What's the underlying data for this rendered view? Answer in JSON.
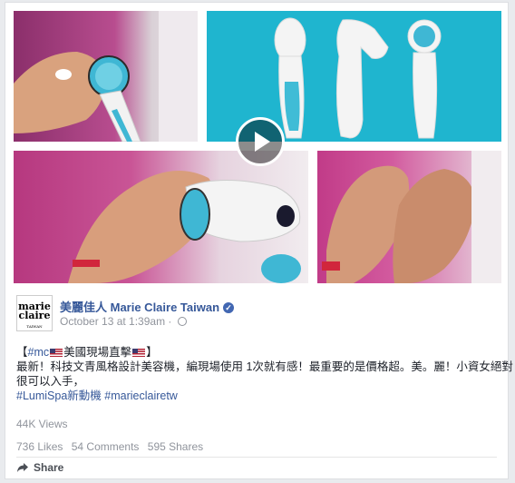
{
  "post": {
    "page_name": "美麗佳人 Marie Claire Taiwan",
    "timestamp": "October 13 at 1:39am",
    "logo_text_1": "marie",
    "logo_text_2": "claire",
    "logo_sub": "TAIWAN",
    "text_line1_pre": "【",
    "text_line1_tag": "#mc",
    "text_line1_mid": "美國現場直擊",
    "text_line1_end": "】",
    "text_line2": "最新！科技文青風格設計美容機，編現場使用 1次就有感！最重要的是價格超。美。麗！小資女絕對",
    "text_line3": "很可以入手，",
    "hashtags": "#LumiSpa新動機 #marieclairetw",
    "views": "44K Views",
    "likes": "736 Likes",
    "comments": "54 Comments",
    "shares": "595 Shares",
    "share_label": "Share"
  },
  "colors": {
    "link": "#365899",
    "muted": "#90949c",
    "background": "#e9ebee"
  }
}
